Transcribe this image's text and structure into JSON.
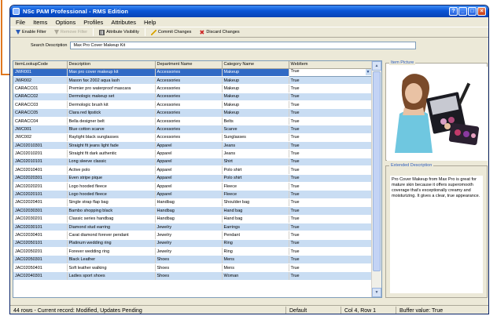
{
  "window": {
    "title": "NSc PAM Professional - RMS Edition"
  },
  "menu": [
    {
      "label": "File"
    },
    {
      "label": "Items"
    },
    {
      "label": "Options"
    },
    {
      "label": "Profiles"
    },
    {
      "label": "Attributes"
    },
    {
      "label": "Help"
    }
  ],
  "toolbar": {
    "enable_filter": "Enable Filter",
    "remove_filter": "Remove Filter",
    "attribute_visibility": "Attribute Visibility",
    "commit_changes": "Commit Changes",
    "discard_changes": "Discard Changes"
  },
  "search": {
    "label": "Search Description",
    "value": "Max Pro Cover Makeup Kit"
  },
  "grid": {
    "columns": [
      "ItemLookupCode",
      "Description",
      "Department Name",
      "Category Name",
      "WebItem"
    ],
    "rows": [
      [
        "JWR001",
        "Max pro cover makeup kit",
        "Accessories",
        "Makeup",
        "True"
      ],
      [
        "JWR002",
        "Mason fax 2002 aqua lash",
        "Accessories",
        "Makeup",
        "True"
      ],
      [
        "CARACC01",
        "Premier pro waterproof mascara",
        "Accessories",
        "Makeup",
        "True"
      ],
      [
        "CARACC02",
        "Dermologic makeup set",
        "Accessories",
        "Makeup",
        "True"
      ],
      [
        "CARACC03",
        "Dermologic brush kit",
        "Accessories",
        "Makeup",
        "True"
      ],
      [
        "CARACC05",
        "Clara red lipstick",
        "Accessories",
        "Makeup",
        "True"
      ],
      [
        "CARACC04",
        "Bella designer belt",
        "Accessories",
        "Belts",
        "True"
      ],
      [
        "JWC001",
        "Blue cotton scarve",
        "Accessories",
        "Scarve",
        "True"
      ],
      [
        "JWC002",
        "Raylight black sunglasses",
        "Accessories",
        "Sunglasses",
        "True"
      ],
      [
        "JAC02010301",
        "Straight fit jeans light fade",
        "Apparel",
        "Jeans",
        "True"
      ],
      [
        "JAC02010201",
        "Straight fit dark authentic",
        "Apparel",
        "Jeans",
        "True"
      ],
      [
        "JAC02010101",
        "Long sleeve classic",
        "Apparel",
        "Shirt",
        "True"
      ],
      [
        "JAC02010401",
        "Active polo",
        "Apparel",
        "Polo shirt",
        "True"
      ],
      [
        "JAC02020301",
        "Even stripe pique",
        "Apparel",
        "Polo shirt",
        "True"
      ],
      [
        "JAC02020201",
        "Logo hooded fleece",
        "Apparel",
        "Fleece",
        "True"
      ],
      [
        "JAC02020101",
        "Logo hooded fleece",
        "Apparel",
        "Fleece",
        "True"
      ],
      [
        "JAC02020401",
        "Single strap flap bag",
        "Handbag",
        "Shoulder bag",
        "True"
      ],
      [
        "JAC02030301",
        "Bambo shopping black",
        "Handbag",
        "Hand bag",
        "True"
      ],
      [
        "JAC02030201",
        "Classic series handbag",
        "Handbag",
        "Hand bag",
        "True"
      ],
      [
        "JAC02030101",
        "Diamond stud earring",
        "Jewelry",
        "Earrings",
        "True"
      ],
      [
        "JAC02030401",
        "Carat diamond forever pendant",
        "Jewelry",
        "Pendant",
        "True"
      ],
      [
        "JAC02050101",
        "Platinum wedding ring",
        "Jewelry",
        "Ring",
        "True"
      ],
      [
        "JAC02050201",
        "Forever wedding ring",
        "Jewelry",
        "Ring",
        "True"
      ],
      [
        "JAC02050301",
        "Black Leather",
        "Shoes",
        "Mens",
        "True"
      ],
      [
        "JAC02050401",
        "Soft leather walking",
        "Shoes",
        "Mens",
        "True"
      ],
      [
        "JAC02040301",
        "Ladies sport shoes",
        "Shoes",
        "Woman",
        "True"
      ]
    ]
  },
  "panel": {
    "item_picture_label": "Item Picture",
    "extended_description_label": "Extended Description",
    "extended_description": "Pro Cover Makeup from Max Pro is great for mature skin because it offers superomooth coverage that's exceptionally creamy and moisturizing. It gives a clear, true appearance."
  },
  "status": {
    "rows": "44 rows - Current record: Modified, Updates Pending",
    "mode": "Default",
    "position": "Col 4, Row 1",
    "buffer": "Buffer value: True"
  },
  "colors": {
    "selection": "#316ac5",
    "alt_row": "#c9ddf3",
    "title_bar": "#0a55d6",
    "accent_bracket": "#e07820"
  }
}
